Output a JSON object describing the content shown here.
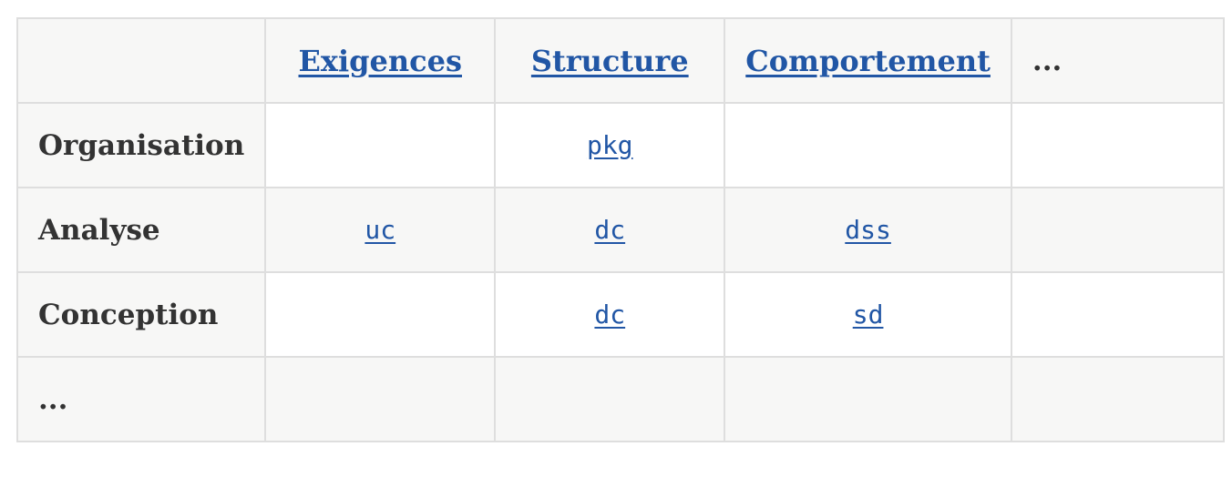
{
  "columns": [
    "",
    "Exigences",
    "Structure",
    "Comportement",
    "..."
  ],
  "rows": [
    {
      "label": "Organisation",
      "cells": [
        "",
        "pkg",
        "",
        ""
      ]
    },
    {
      "label": "Analyse",
      "cells": [
        "uc",
        "dc",
        "dss",
        ""
      ]
    },
    {
      "label": "Conception",
      "cells": [
        "",
        "dc",
        "sd",
        ""
      ]
    },
    {
      "label": "...",
      "cells": [
        "",
        "",
        "",
        ""
      ]
    }
  ],
  "colors": {
    "link": "#2156a5",
    "text": "#333333",
    "stripe": "#f7f7f6",
    "border": "#dedede"
  }
}
